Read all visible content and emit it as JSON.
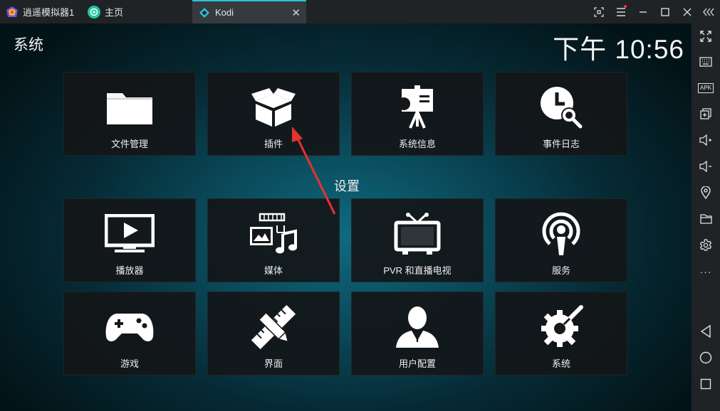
{
  "titlebar": {
    "emulator_tab": "逍遥模拟器1",
    "home_tab": "主页",
    "kodi_tab": "Kodi",
    "kodi_close": "✕",
    "accent": "#2ec0d6"
  },
  "kodi": {
    "header": "系统",
    "clock": "下午 10:56",
    "section_label": "设置",
    "top_tiles": [
      {
        "label": "文件管理",
        "icon": "folder-icon"
      },
      {
        "label": "插件",
        "icon": "box-icon"
      },
      {
        "label": "系统信息",
        "icon": "presentation-icon"
      },
      {
        "label": "事件日志",
        "icon": "clock-search-icon"
      }
    ],
    "tiles": [
      {
        "label": "播放器",
        "icon": "monitor-play-icon"
      },
      {
        "label": "媒体",
        "icon": "media-icon"
      },
      {
        "label": "PVR 和直播电视",
        "icon": "tv-icon"
      },
      {
        "label": "服务",
        "icon": "podcast-icon"
      },
      {
        "label": "游戏",
        "icon": "gamepad-icon"
      },
      {
        "label": "界面",
        "icon": "pencil-ruler-icon"
      },
      {
        "label": "用户配置",
        "icon": "user-icon"
      },
      {
        "label": "系统",
        "icon": "gears-icon"
      }
    ]
  },
  "sidebar": {
    "items": [
      "fullscreen-icon",
      "keyboard-icon",
      "apk-icon",
      "multi-window-icon",
      "volume-up-icon",
      "volume-down-icon",
      "location-icon",
      "folder-icon",
      "settings-icon",
      "more-icon",
      "back-icon",
      "home-icon",
      "recents-icon"
    ],
    "apk_label": "APK",
    "more_label": "···"
  }
}
